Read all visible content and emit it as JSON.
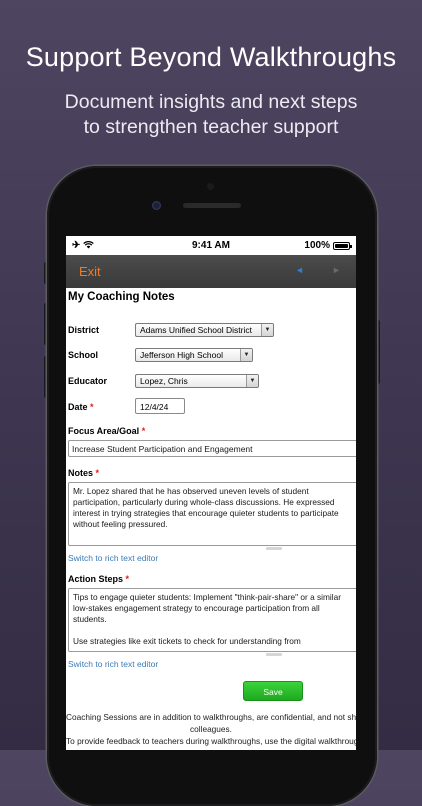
{
  "marketing": {
    "headline": "Support Beyond Walkthroughs",
    "subline_1": "Document insights and next steps",
    "subline_2": "to strengthen teacher support"
  },
  "status_bar": {
    "time": "9:41 AM",
    "battery": "100%",
    "icons": [
      "airplane-icon",
      "wifi-icon",
      "battery-icon"
    ]
  },
  "navbar": {
    "exit_label": "Exit",
    "back_icon": "◄",
    "forward_icon": "►"
  },
  "form": {
    "title": "My Coaching Notes",
    "district": {
      "label": "District",
      "value": "Adams Unified School District"
    },
    "school": {
      "label": "School",
      "value": "Jefferson High School"
    },
    "educator": {
      "label": "Educator",
      "value": "Lopez, Chris"
    },
    "date": {
      "label": "Date",
      "required_mark": "*",
      "value": "12/4/24"
    },
    "focus": {
      "label": "Focus Area/Goal",
      "required_mark": "*",
      "value": "Increase Student Participation and Engagement"
    },
    "notes": {
      "label": "Notes",
      "required_mark": "*",
      "value": "Mr. Lopez shared that he has observed uneven levels of student participation, particularly during whole-class discussions. He expressed interest in trying strategies that encourage quieter students to participate without feeling pressured."
    },
    "notes_link": "Switch to rich text editor",
    "action_steps": {
      "label": "Action Steps",
      "required_mark": "*",
      "para_1": "Tips to engage quieter students: Implement \"think-pair-share\" or a similar low-stakes engagement strategy to encourage participation from all students.",
      "para_2": "Use strategies like exit tickets to check for understanding from"
    },
    "action_link": "Switch to rich text editor",
    "save_label": "Save"
  },
  "footer": {
    "line_1": "Coaching Sessions are in addition to walkthroughs, are confidential, and not shared with colleagues.",
    "line_2": "colleagues.",
    "line_3": "To provide feedback to teachers during walkthroughs, use the digital walkthrough form."
  },
  "colors": {
    "background": "#433b56",
    "exit": "#f07a28",
    "nav_active": "#2d7fd6",
    "link": "#3a7ab8",
    "save": "#2cc22c",
    "required": "#d21f1f"
  }
}
